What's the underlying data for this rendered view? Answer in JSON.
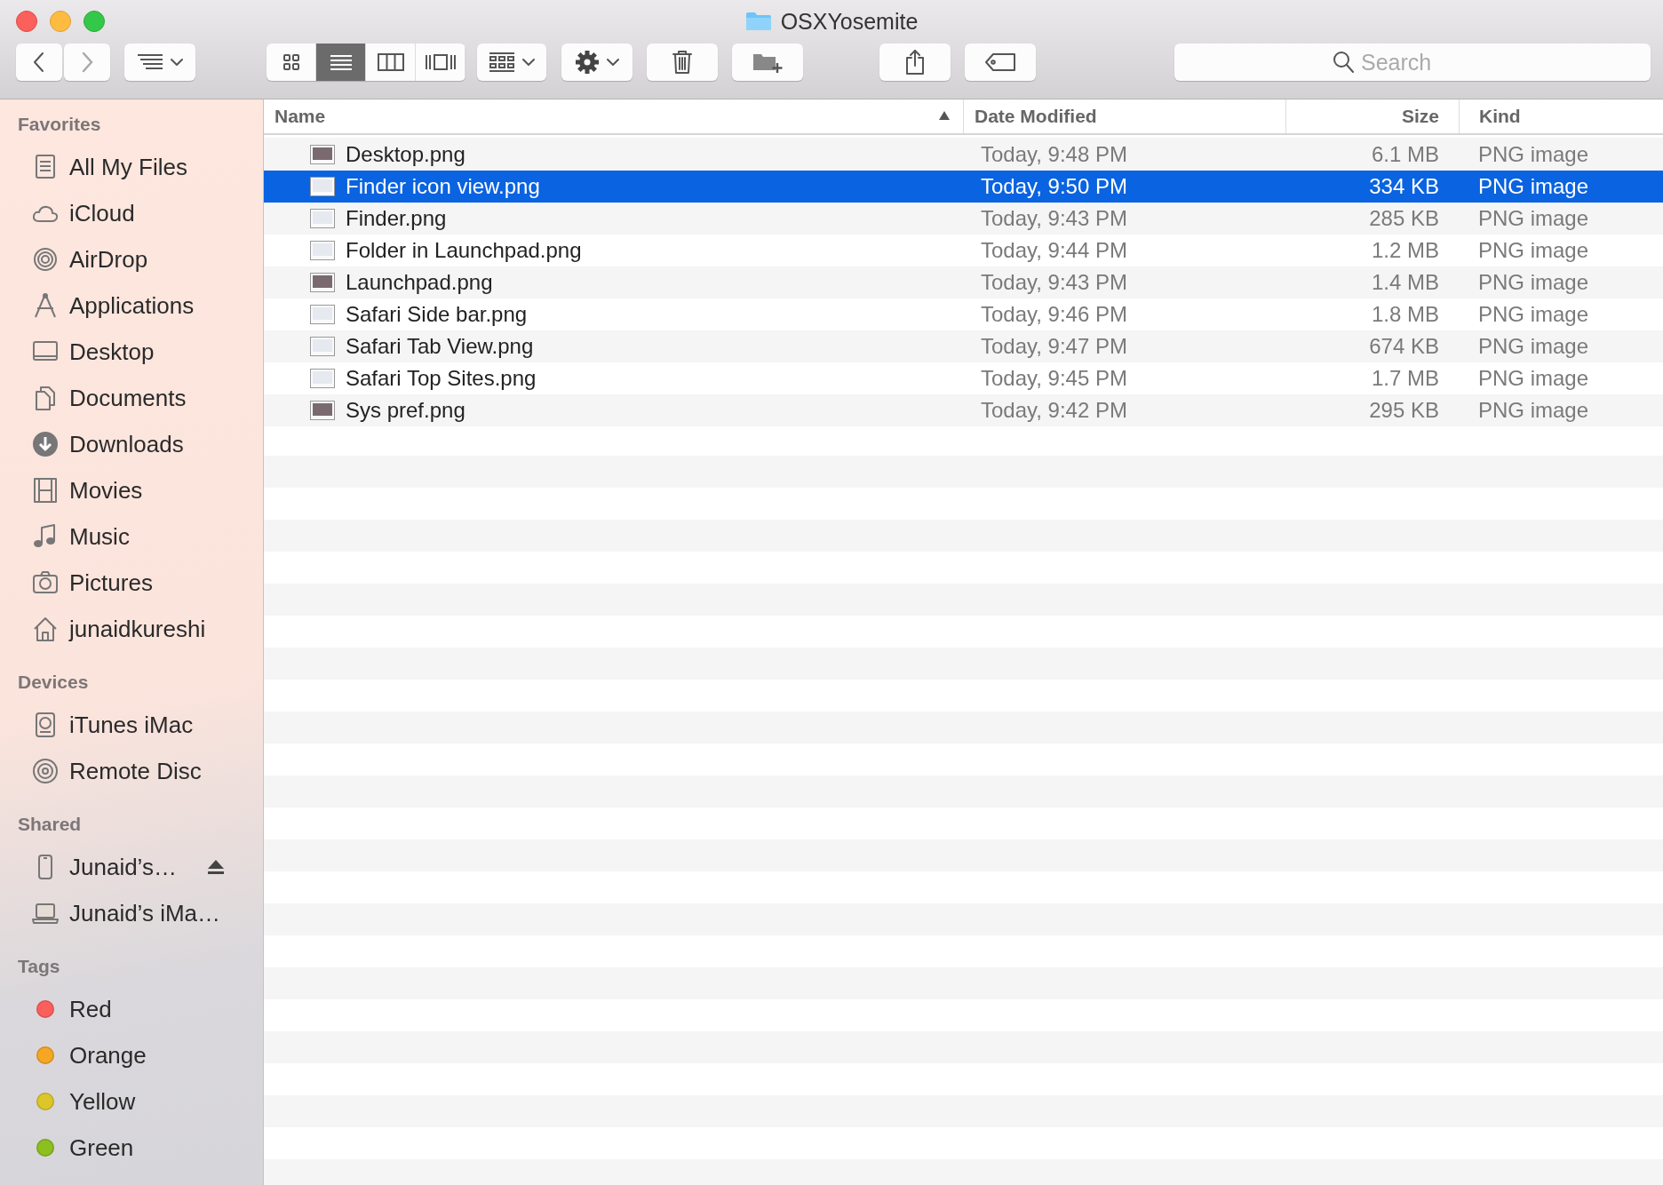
{
  "window": {
    "title": "OSXYosemite"
  },
  "toolbar": {
    "view_modes": [
      {
        "selected": false
      },
      {
        "selected": true
      },
      {
        "selected": false
      },
      {
        "selected": false
      }
    ],
    "search": {
      "placeholder": "Search"
    }
  },
  "sidebar": {
    "sections": [
      {
        "heading": "Favorites",
        "items": [
          {
            "label": "All My Files"
          },
          {
            "label": "iCloud"
          },
          {
            "label": "AirDrop"
          },
          {
            "label": "Applications"
          },
          {
            "label": "Desktop"
          },
          {
            "label": "Documents"
          },
          {
            "label": "Downloads"
          },
          {
            "label": "Movies"
          },
          {
            "label": "Music"
          },
          {
            "label": "Pictures"
          },
          {
            "label": "junaidkureshi"
          }
        ]
      },
      {
        "heading": "Devices",
        "items": [
          {
            "label": "iTunes iMac"
          },
          {
            "label": "Remote Disc"
          }
        ]
      },
      {
        "heading": "Shared",
        "items": [
          {
            "label": "Junaid’s…",
            "eject": true
          },
          {
            "label": "Junaid’s iMa…",
            "eject": false
          }
        ]
      },
      {
        "heading": "Tags",
        "items": [
          {
            "label": "Red",
            "color": "#fc605c"
          },
          {
            "label": "Orange",
            "color": "#f5a623"
          },
          {
            "label": "Yellow",
            "color": "#dcc62a"
          },
          {
            "label": "Green",
            "color": "#8cbf1f"
          }
        ]
      }
    ]
  },
  "table": {
    "columns": [
      {
        "label": "Name",
        "sorted": true
      },
      {
        "label": "Date Modified",
        "sorted": false
      },
      {
        "label": "Size",
        "sorted": false
      },
      {
        "label": "Kind",
        "sorted": false
      }
    ],
    "rows": [
      {
        "name": "Desktop.png",
        "date": "Today, 9:48 PM",
        "size": "6.1 MB",
        "kind": "PNG image",
        "selected": false
      },
      {
        "name": "Finder icon view.png",
        "date": "Today, 9:50 PM",
        "size": "334 KB",
        "kind": "PNG image",
        "selected": true
      },
      {
        "name": "Finder.png",
        "date": "Today, 9:43 PM",
        "size": "285 KB",
        "kind": "PNG image",
        "selected": false
      },
      {
        "name": "Folder in Launchpad.png",
        "date": "Today, 9:44 PM",
        "size": "1.2 MB",
        "kind": "PNG image",
        "selected": false
      },
      {
        "name": "Launchpad.png",
        "date": "Today, 9:43 PM",
        "size": "1.4 MB",
        "kind": "PNG image",
        "selected": false
      },
      {
        "name": "Safari Side bar.png",
        "date": "Today, 9:46 PM",
        "size": "1.8 MB",
        "kind": "PNG image",
        "selected": false
      },
      {
        "name": "Safari Tab View.png",
        "date": "Today, 9:47 PM",
        "size": "674 KB",
        "kind": "PNG image",
        "selected": false
      },
      {
        "name": "Safari Top Sites.png",
        "date": "Today, 9:45 PM",
        "size": "1.7 MB",
        "kind": "PNG image",
        "selected": false
      },
      {
        "name": "Sys pref.png",
        "date": "Today, 9:42 PM",
        "size": "295 KB",
        "kind": "PNG image",
        "selected": false
      }
    ]
  }
}
